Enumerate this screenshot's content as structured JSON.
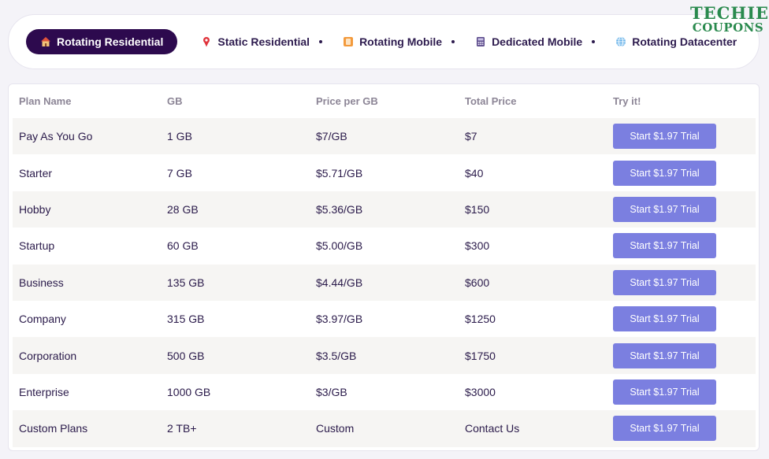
{
  "logo": {
    "line1": "TECHIE",
    "line2": "COUPONS"
  },
  "tabs": [
    {
      "label": "Rotating Residential",
      "icon": "house-icon",
      "active": true
    },
    {
      "label": "Static Residential",
      "icon": "pin-icon",
      "active": false
    },
    {
      "label": "Rotating Mobile",
      "icon": "mobile-phone-icon",
      "active": false
    },
    {
      "label": "Dedicated Mobile",
      "icon": "calculator-icon",
      "active": false
    },
    {
      "label": "Rotating Datacenter",
      "icon": "globe-icon",
      "active": false
    }
  ],
  "table": {
    "headers": [
      "Plan Name",
      "GB",
      "Price per GB",
      "Total Price",
      "Try it!"
    ],
    "button_label": "Start $1.97 Trial",
    "rows": [
      {
        "plan": "Pay As You Go",
        "gb": "1 GB",
        "price_per_gb": "$7/GB",
        "total": "$7"
      },
      {
        "plan": "Starter",
        "gb": "7 GB",
        "price_per_gb": "$5.71/GB",
        "total": "$40"
      },
      {
        "plan": "Hobby",
        "gb": "28 GB",
        "price_per_gb": "$5.36/GB",
        "total": "$150"
      },
      {
        "plan": "Startup",
        "gb": "60 GB",
        "price_per_gb": "$5.00/GB",
        "total": "$300"
      },
      {
        "plan": "Business",
        "gb": "135 GB",
        "price_per_gb": "$4.44/GB",
        "total": "$600"
      },
      {
        "plan": "Company",
        "gb": "315 GB",
        "price_per_gb": "$3.97/GB",
        "total": "$1250"
      },
      {
        "plan": "Corporation",
        "gb": "500 GB",
        "price_per_gb": "$3.5/GB",
        "total": "$1750"
      },
      {
        "plan": "Enterprise",
        "gb": "1000 GB",
        "price_per_gb": "$3/GB",
        "total": "$3000"
      },
      {
        "plan": "Custom Plans",
        "gb": "2 TB+",
        "price_per_gb": "Custom",
        "total": "Contact Us"
      }
    ]
  },
  "colors": {
    "active_tab_bg": "#2d0a4e",
    "button_bg": "#7b7fe0",
    "logo_green": "#2a8a4e",
    "stripe_bg": "#f6f5f3"
  }
}
